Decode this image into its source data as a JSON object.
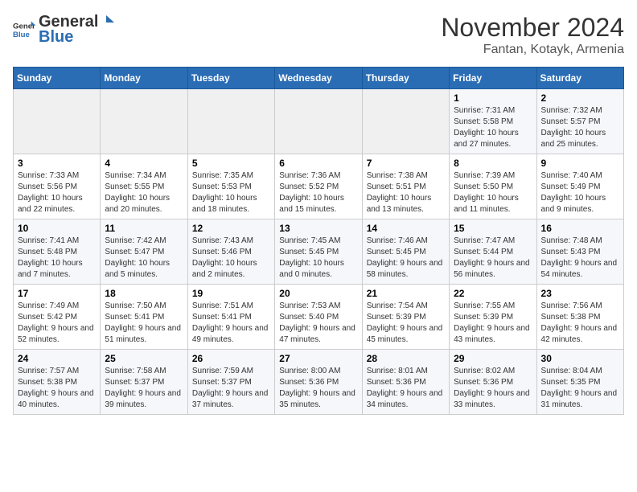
{
  "header": {
    "logo_general": "General",
    "logo_blue": "Blue",
    "month": "November 2024",
    "location": "Fantan, Kotayk, Armenia"
  },
  "weekdays": [
    "Sunday",
    "Monday",
    "Tuesday",
    "Wednesday",
    "Thursday",
    "Friday",
    "Saturday"
  ],
  "weeks": [
    [
      {
        "day": "",
        "info": ""
      },
      {
        "day": "",
        "info": ""
      },
      {
        "day": "",
        "info": ""
      },
      {
        "day": "",
        "info": ""
      },
      {
        "day": "",
        "info": ""
      },
      {
        "day": "1",
        "info": "Sunrise: 7:31 AM\nSunset: 5:58 PM\nDaylight: 10 hours and 27 minutes."
      },
      {
        "day": "2",
        "info": "Sunrise: 7:32 AM\nSunset: 5:57 PM\nDaylight: 10 hours and 25 minutes."
      }
    ],
    [
      {
        "day": "3",
        "info": "Sunrise: 7:33 AM\nSunset: 5:56 PM\nDaylight: 10 hours and 22 minutes."
      },
      {
        "day": "4",
        "info": "Sunrise: 7:34 AM\nSunset: 5:55 PM\nDaylight: 10 hours and 20 minutes."
      },
      {
        "day": "5",
        "info": "Sunrise: 7:35 AM\nSunset: 5:53 PM\nDaylight: 10 hours and 18 minutes."
      },
      {
        "day": "6",
        "info": "Sunrise: 7:36 AM\nSunset: 5:52 PM\nDaylight: 10 hours and 15 minutes."
      },
      {
        "day": "7",
        "info": "Sunrise: 7:38 AM\nSunset: 5:51 PM\nDaylight: 10 hours and 13 minutes."
      },
      {
        "day": "8",
        "info": "Sunrise: 7:39 AM\nSunset: 5:50 PM\nDaylight: 10 hours and 11 minutes."
      },
      {
        "day": "9",
        "info": "Sunrise: 7:40 AM\nSunset: 5:49 PM\nDaylight: 10 hours and 9 minutes."
      }
    ],
    [
      {
        "day": "10",
        "info": "Sunrise: 7:41 AM\nSunset: 5:48 PM\nDaylight: 10 hours and 7 minutes."
      },
      {
        "day": "11",
        "info": "Sunrise: 7:42 AM\nSunset: 5:47 PM\nDaylight: 10 hours and 5 minutes."
      },
      {
        "day": "12",
        "info": "Sunrise: 7:43 AM\nSunset: 5:46 PM\nDaylight: 10 hours and 2 minutes."
      },
      {
        "day": "13",
        "info": "Sunrise: 7:45 AM\nSunset: 5:45 PM\nDaylight: 10 hours and 0 minutes."
      },
      {
        "day": "14",
        "info": "Sunrise: 7:46 AM\nSunset: 5:45 PM\nDaylight: 9 hours and 58 minutes."
      },
      {
        "day": "15",
        "info": "Sunrise: 7:47 AM\nSunset: 5:44 PM\nDaylight: 9 hours and 56 minutes."
      },
      {
        "day": "16",
        "info": "Sunrise: 7:48 AM\nSunset: 5:43 PM\nDaylight: 9 hours and 54 minutes."
      }
    ],
    [
      {
        "day": "17",
        "info": "Sunrise: 7:49 AM\nSunset: 5:42 PM\nDaylight: 9 hours and 52 minutes."
      },
      {
        "day": "18",
        "info": "Sunrise: 7:50 AM\nSunset: 5:41 PM\nDaylight: 9 hours and 51 minutes."
      },
      {
        "day": "19",
        "info": "Sunrise: 7:51 AM\nSunset: 5:41 PM\nDaylight: 9 hours and 49 minutes."
      },
      {
        "day": "20",
        "info": "Sunrise: 7:53 AM\nSunset: 5:40 PM\nDaylight: 9 hours and 47 minutes."
      },
      {
        "day": "21",
        "info": "Sunrise: 7:54 AM\nSunset: 5:39 PM\nDaylight: 9 hours and 45 minutes."
      },
      {
        "day": "22",
        "info": "Sunrise: 7:55 AM\nSunset: 5:39 PM\nDaylight: 9 hours and 43 minutes."
      },
      {
        "day": "23",
        "info": "Sunrise: 7:56 AM\nSunset: 5:38 PM\nDaylight: 9 hours and 42 minutes."
      }
    ],
    [
      {
        "day": "24",
        "info": "Sunrise: 7:57 AM\nSunset: 5:38 PM\nDaylight: 9 hours and 40 minutes."
      },
      {
        "day": "25",
        "info": "Sunrise: 7:58 AM\nSunset: 5:37 PM\nDaylight: 9 hours and 39 minutes."
      },
      {
        "day": "26",
        "info": "Sunrise: 7:59 AM\nSunset: 5:37 PM\nDaylight: 9 hours and 37 minutes."
      },
      {
        "day": "27",
        "info": "Sunrise: 8:00 AM\nSunset: 5:36 PM\nDaylight: 9 hours and 35 minutes."
      },
      {
        "day": "28",
        "info": "Sunrise: 8:01 AM\nSunset: 5:36 PM\nDaylight: 9 hours and 34 minutes."
      },
      {
        "day": "29",
        "info": "Sunrise: 8:02 AM\nSunset: 5:36 PM\nDaylight: 9 hours and 33 minutes."
      },
      {
        "day": "30",
        "info": "Sunrise: 8:04 AM\nSunset: 5:35 PM\nDaylight: 9 hours and 31 minutes."
      }
    ]
  ]
}
